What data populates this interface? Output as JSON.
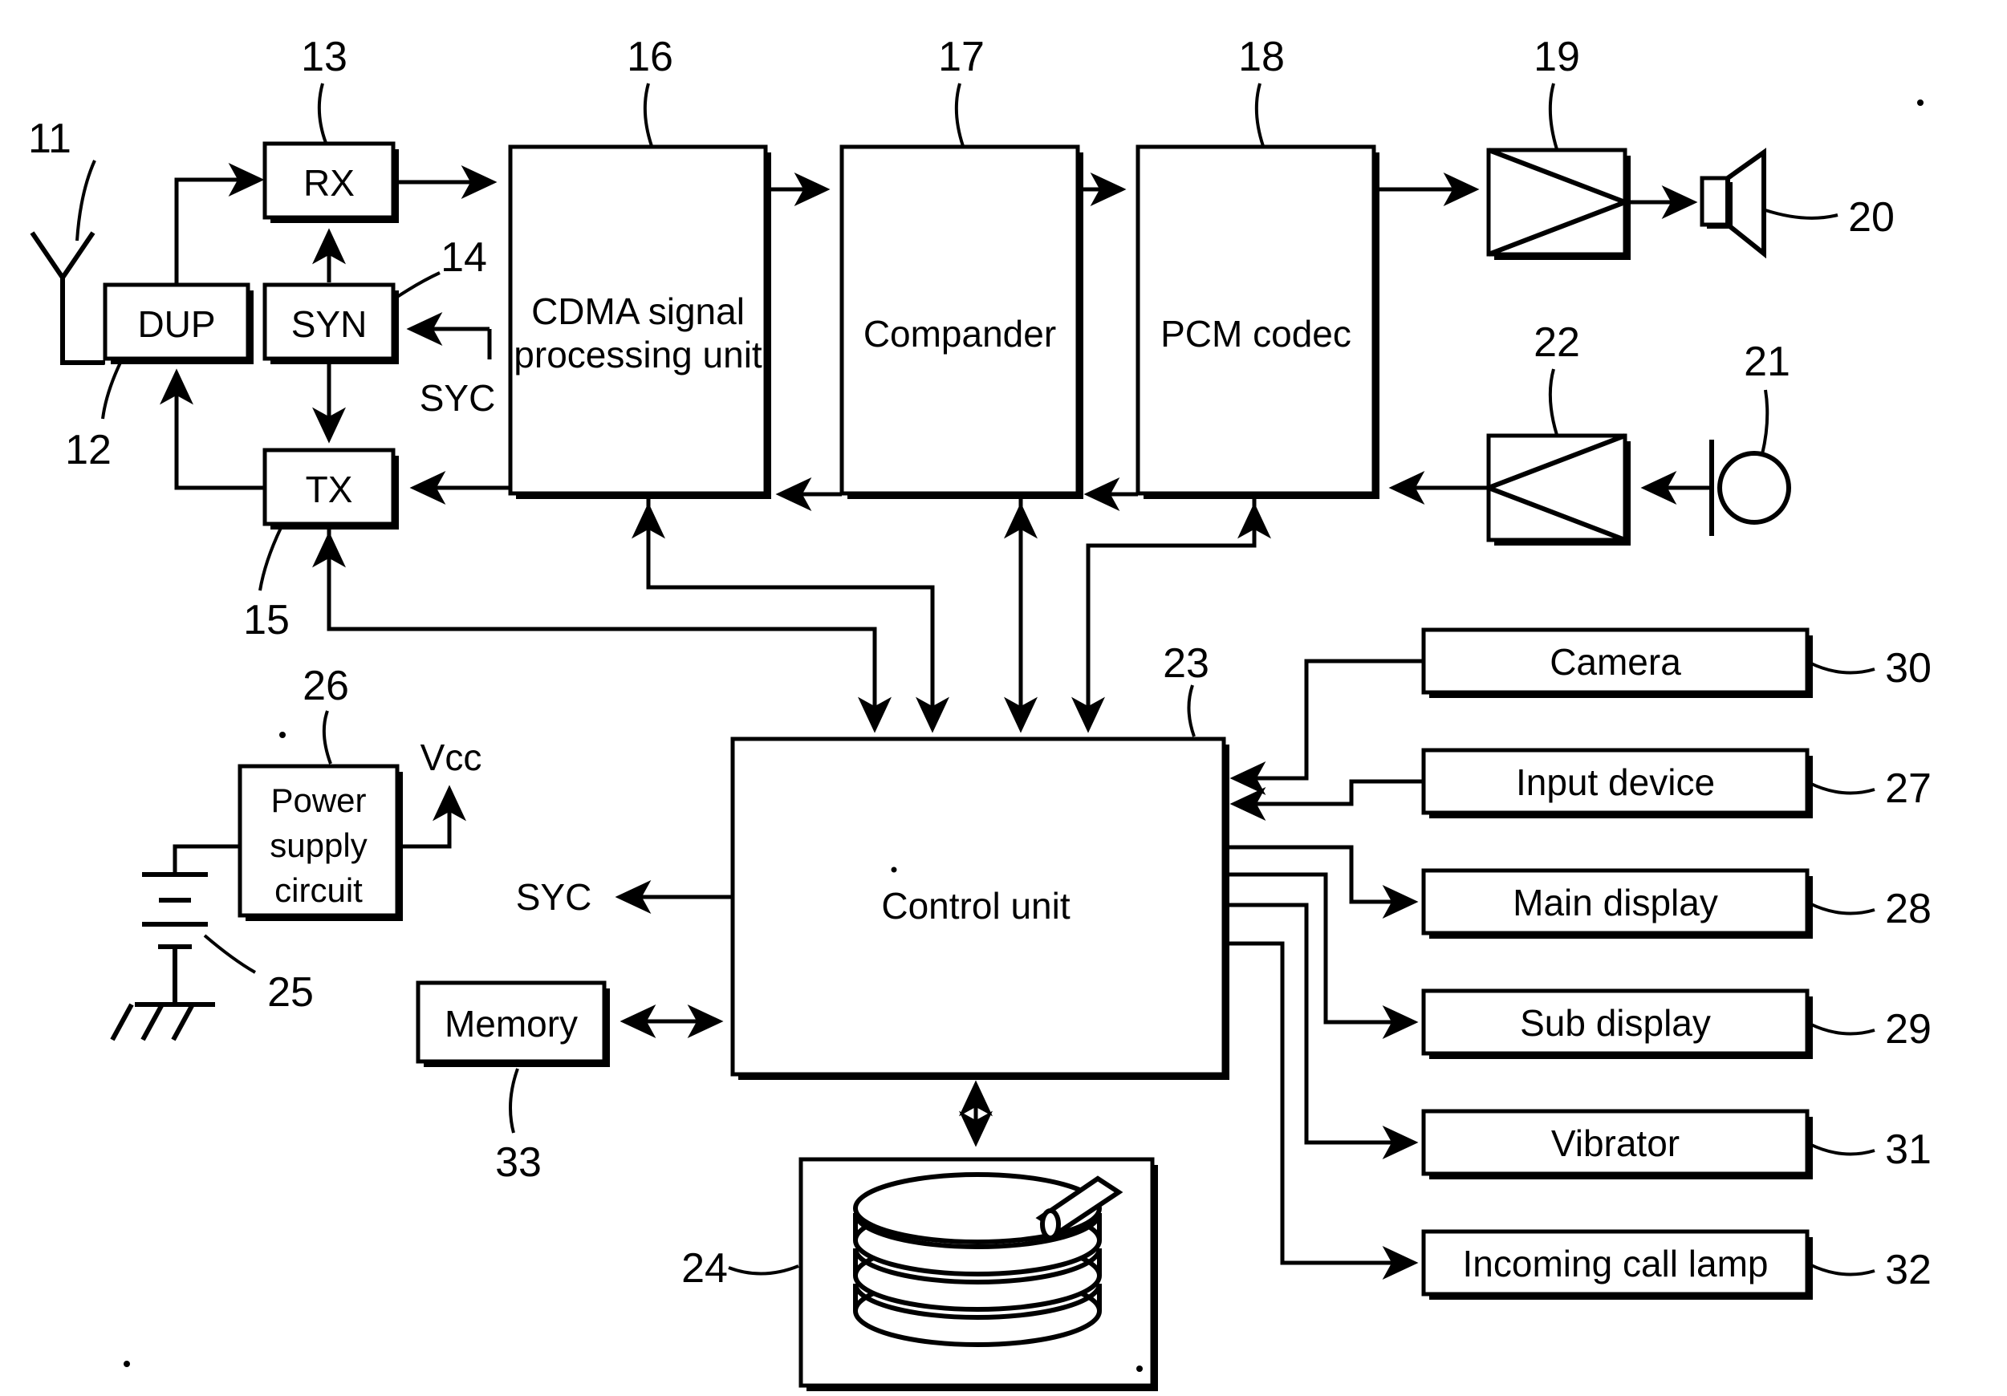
{
  "figure": {
    "title": "CDMA mobile terminal block diagram",
    "signal_labels": {
      "syc_syn": "SYC",
      "syc_control": "SYC",
      "vcc": "Vcc"
    }
  },
  "blocks": {
    "dup": {
      "label": "DUP",
      "ref": "12"
    },
    "rx": {
      "label": "RX",
      "ref": "13"
    },
    "syn": {
      "label": "SYN",
      "ref": "14"
    },
    "tx": {
      "label": "TX",
      "ref": "15"
    },
    "cdma": {
      "label_line1": "CDMA  signal",
      "label_line2": "processing unit",
      "ref": "16"
    },
    "compander": {
      "label": "Compander",
      "ref": "17"
    },
    "pcm": {
      "label": "PCM codec",
      "ref": "18"
    },
    "control": {
      "label": "Control unit",
      "ref": "23"
    },
    "power": {
      "label_line1": "Power",
      "label_line2": "supply",
      "label_line3": "circuit",
      "ref": "26"
    },
    "memory": {
      "label": "Memory",
      "ref": "33"
    },
    "camera": {
      "label": "Camera",
      "ref": "30"
    },
    "input": {
      "label": "Input  device",
      "ref": "27"
    },
    "maindisp": {
      "label": "Main  display",
      "ref": "28"
    },
    "subdisp": {
      "label": "Sub  display",
      "ref": "29"
    },
    "vibrator": {
      "label": "Vibrator",
      "ref": "31"
    },
    "lamp": {
      "label": "Incoming  call  lamp",
      "ref": "32"
    }
  },
  "symbols": {
    "antenna": {
      "ref": "11"
    },
    "amp_out": {
      "ref": "19"
    },
    "speaker": {
      "ref": "20"
    },
    "microphone": {
      "ref": "21"
    },
    "amp_in": {
      "ref": "22"
    },
    "storage": {
      "ref": "24"
    },
    "battery": {
      "ref": "25"
    }
  },
  "colors": {
    "line": "#000000",
    "background": "#ffffff"
  }
}
